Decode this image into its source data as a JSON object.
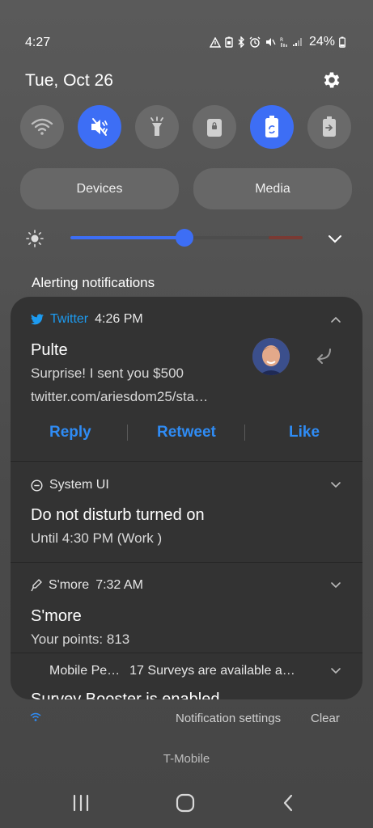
{
  "status_bar": {
    "time": "4:27",
    "battery": "24%",
    "icons": [
      "alert-triangle-icon",
      "battery-saver-icon",
      "bluetooth-icon",
      "alarm-icon",
      "mute-icon",
      "volte-icon",
      "signal-icon",
      "battery-icon"
    ]
  },
  "header": {
    "date": "Tue, Oct 26",
    "settings_icon": "gear-icon"
  },
  "quick_toggles": [
    {
      "name": "wifi",
      "icon": "wifi-icon",
      "on": false
    },
    {
      "name": "mute",
      "icon": "mute-icon",
      "on": true
    },
    {
      "name": "flashlight",
      "icon": "flashlight-icon",
      "on": false
    },
    {
      "name": "secure-folder",
      "icon": "lock-icon",
      "on": false
    },
    {
      "name": "power-saving",
      "icon": "battery-recycle-icon",
      "on": true
    },
    {
      "name": "battery-share",
      "icon": "battery-share-icon",
      "on": false
    }
  ],
  "pills": {
    "devices": "Devices",
    "media": "Media"
  },
  "brightness": {
    "level": 0.49
  },
  "notifications": {
    "section_title": "Alerting notifications",
    "twitter": {
      "app": "Twitter",
      "time": "4:26 PM",
      "title": "Pulte",
      "text": "Surprise! I sent you $500",
      "link": "twitter.com/ariesdom25/sta…",
      "actions": {
        "reply": "Reply",
        "retweet": "Retweet",
        "like": "Like"
      }
    },
    "system_ui": {
      "app": "System UI",
      "title": "Do not disturb turned on",
      "text": "Until 4:30 PM (Work )"
    },
    "smore": {
      "app": "S'more",
      "time": "7:32 AM",
      "title": "S'more",
      "text": "Your points: 813"
    },
    "mobile_pe": {
      "app": "Mobile Pe…",
      "text": "17 Surveys are available a…",
      "title_partial": "Survey Booster is enabled"
    }
  },
  "footer": {
    "notification_settings": "Notification settings",
    "clear": "Clear",
    "carrier": "T-Mobile"
  },
  "colors": {
    "accent": "#3d6ef5",
    "twitter_blue": "#1d9bf0",
    "action_blue": "#2f8cf5",
    "panel": "#333333"
  }
}
